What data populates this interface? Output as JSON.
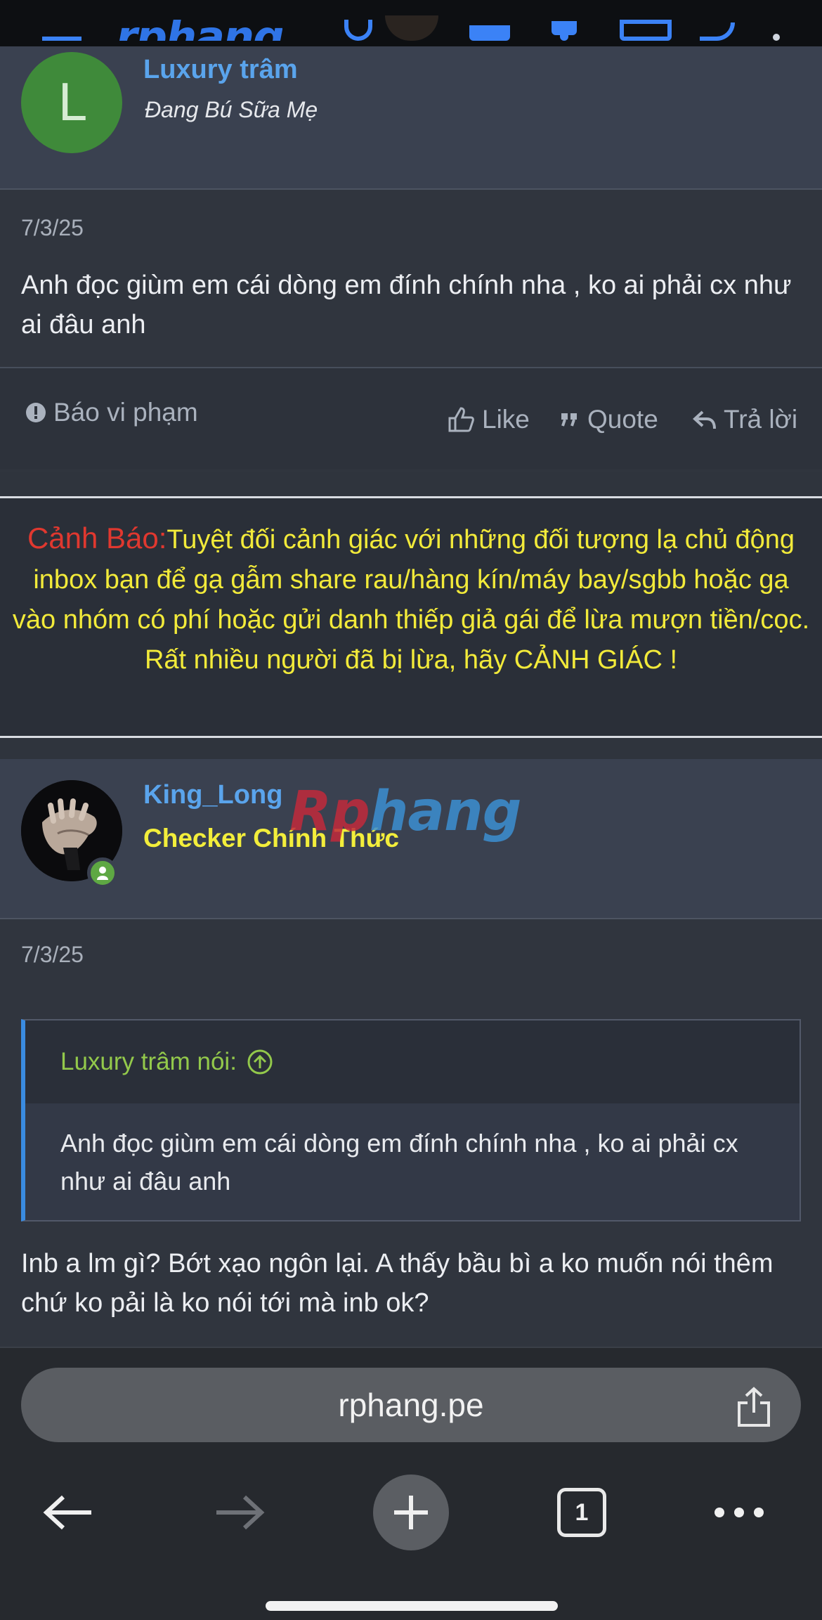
{
  "post1": {
    "avatar_letter": "L",
    "username": "Luxury trâm",
    "user_title": "Đang Bú Sữa Mẹ",
    "date": "7/3/25",
    "body": "Anh đọc giùm em cái dòng em đính chính nha , ko ai phải cx như ai đâu anh",
    "actions": {
      "report": "Báo vi phạm",
      "like": "Like",
      "quote": "Quote",
      "reply": "Trả lời"
    }
  },
  "warning": {
    "label": "Cảnh Báo:",
    "text": "Tuyệt đối cảnh giác với những đối tượng lạ chủ động inbox bạn để gạ gẫm share rau/hàng kín/máy bay/sgbb hoặc gạ vào nhóm có phí hoặc gửi danh thiếp giả gái để lừa mượn tiền/cọc.",
    "text2": "Rất nhiều người đã bị lừa, hãy CẢNH GIÁC !"
  },
  "post2": {
    "username": "King_Long",
    "user_title": "Checker Chính Thức",
    "banner_a": "Rp",
    "banner_b": "hang",
    "date": "7/3/25",
    "quote_author": "Luxury trâm nói:",
    "quote_body": "Anh đọc giùm em cái dòng em đính chính nha , ko ai phải cx như ai đâu anh",
    "body": "Inb a lm gì? Bớt xạo ngôn lại. A thấy bầu bì a ko muốn nói thêm chứ ko pải là ko nói tới mà inb ok?"
  },
  "browser": {
    "url": "rphang.pe",
    "tab_count": "1"
  },
  "colors": {
    "accent": "#3b82f6",
    "username": "#5aa4ec",
    "warning_red": "#e0382f",
    "warning_yellow": "#f2ea3a",
    "quote_green": "#93c94b"
  }
}
